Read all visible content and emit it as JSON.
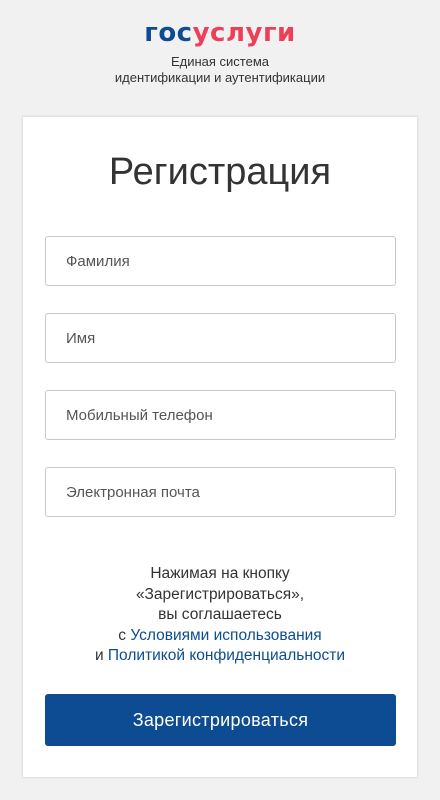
{
  "brand": {
    "logo_part1": "гос",
    "logo_part2": "услуги",
    "subtitle_line1": "Единая система",
    "subtitle_line2": "идентификации и аутентификации",
    "primary_color": "#0d4c92",
    "accent_color": "#ee3f58"
  },
  "form": {
    "title": "Регистрация",
    "fields": [
      {
        "placeholder": "Фамилия",
        "value": ""
      },
      {
        "placeholder": "Имя",
        "value": ""
      },
      {
        "placeholder": "Мобильный телефон",
        "value": ""
      },
      {
        "placeholder": "Электронная почта",
        "value": ""
      }
    ],
    "consent": {
      "line1": "Нажимая на кнопку",
      "line2": "«Зарегистрироваться»,",
      "line3": "вы соглашаетесь",
      "prefix1": "с ",
      "terms_link": "Условиями использования",
      "prefix2": "и ",
      "privacy_link": "Политикой конфиденциальности"
    },
    "submit_label": "Зарегистрироваться"
  }
}
